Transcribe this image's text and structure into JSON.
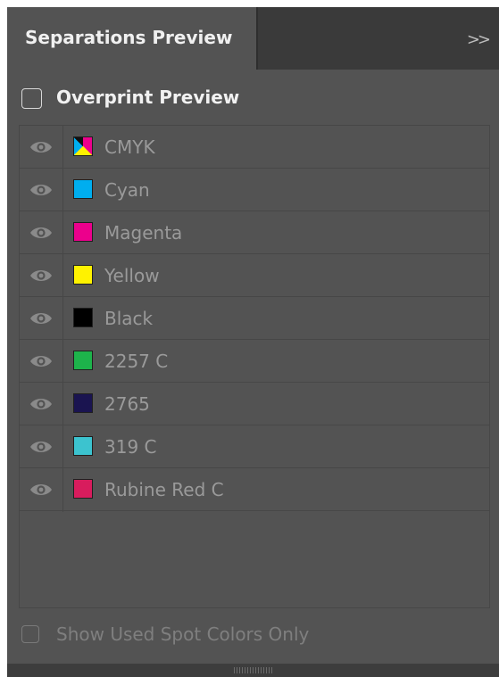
{
  "panel": {
    "title": "Separations Preview",
    "collapse_icon": "double-chevron-right-icon",
    "overprint_preview": {
      "label": "Overprint Preview",
      "checked": false
    },
    "separations": [
      {
        "name": "CMYK",
        "visible": true,
        "swatch": "cmyk-composite",
        "color": ""
      },
      {
        "name": "Cyan",
        "visible": true,
        "swatch": "solid",
        "color": "#00aeef"
      },
      {
        "name": "Magenta",
        "visible": true,
        "swatch": "solid",
        "color": "#ec008c"
      },
      {
        "name": "Yellow",
        "visible": true,
        "swatch": "solid",
        "color": "#fff200"
      },
      {
        "name": "Black",
        "visible": true,
        "swatch": "solid",
        "color": "#000000"
      },
      {
        "name": "2257 C",
        "visible": true,
        "swatch": "solid",
        "color": "#1db34b"
      },
      {
        "name": "2765",
        "visible": true,
        "swatch": "solid",
        "color": "#1a1450"
      },
      {
        "name": "319 C",
        "visible": true,
        "swatch": "solid",
        "color": "#3cc3cf"
      },
      {
        "name": "Rubine Red C",
        "visible": true,
        "swatch": "solid",
        "color": "#d81c5d"
      }
    ],
    "show_used_spot_colors_only": {
      "label": "Show Used Spot Colors Only",
      "checked": false,
      "enabled": false
    }
  }
}
